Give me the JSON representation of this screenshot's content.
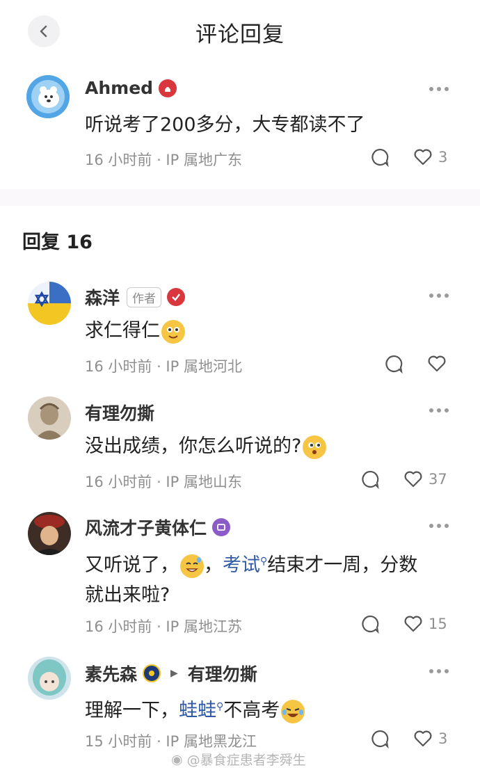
{
  "header": {
    "title": "评论回复"
  },
  "root_comment": {
    "user": "Ahmed",
    "text": "听说考了200多分，大专都读不了",
    "meta": "16 小时前 · IP 属地广东",
    "likes": "3"
  },
  "replies_heading": "回复 16",
  "replies": [
    {
      "user": "森洋",
      "tag": "作者",
      "text": "求仁得仁",
      "meta": "16 小时前 · IP 属地河北",
      "likes": ""
    },
    {
      "user": "有理勿撕",
      "text": "没出成绩，你怎么听说的?",
      "meta": "16 小时前 · IP 属地山东",
      "likes": "37"
    },
    {
      "user": "风流才子黄体仁",
      "text_a": "又听说了，",
      "text_b": "，",
      "link": "考试",
      "text_c": "结束才一周，分数",
      "text_d": "就出来啦?",
      "meta": "16 小时前 · IP 属地江苏",
      "likes": "15"
    },
    {
      "user": "素先森",
      "reply_to": "有理勿撕",
      "text_a": "理解一下，",
      "link": "蛙蛙",
      "text_b": "不高考",
      "meta": "15 小时前 · IP 属地黑龙江",
      "likes": "3"
    }
  ],
  "watermark": "@暴食症患者李舜生",
  "colors": {
    "link": "#2f5aa6",
    "meta": "#8f8f8f",
    "badge_red": "#d9363e",
    "badge_purple": "#8b5cc7"
  },
  "icons": [
    "back-arrow-icon",
    "more-icon",
    "comment-icon",
    "heart-icon",
    "search-mark-icon"
  ]
}
